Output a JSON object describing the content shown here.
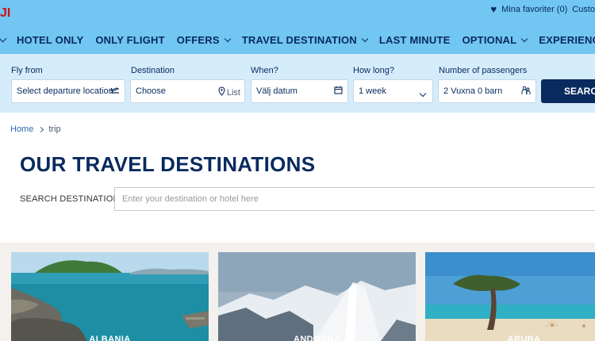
{
  "brand": {
    "logo_text": "JI"
  },
  "utility": {
    "favorites_label": "Mina favoriter (0)",
    "customer_label": "Custo"
  },
  "nav": {
    "items": [
      {
        "label": "HOTEL ONLY",
        "has_dropdown": false
      },
      {
        "label": "ONLY FLIGHT",
        "has_dropdown": false
      },
      {
        "label": "OFFERS",
        "has_dropdown": true
      },
      {
        "label": "TRAVEL DESTINATION",
        "has_dropdown": true
      },
      {
        "label": "LAST MINUTE",
        "has_dropdown": false
      },
      {
        "label": "OPTIONAL",
        "has_dropdown": true
      },
      {
        "label": "EXPERIENCES",
        "has_dropdown": false
      }
    ]
  },
  "search": {
    "fly_from": {
      "label": "Fly from",
      "value": "Select departure location",
      "icon": "plane-departure-icon"
    },
    "destination": {
      "label": "Destination",
      "value": "Choose",
      "list_label": "List",
      "icon": "map-pin-icon"
    },
    "when": {
      "label": "When?",
      "value": "Välj datum",
      "icon": "calendar-icon"
    },
    "how_long": {
      "label": "How long?",
      "value": "1 week",
      "icon": "chevron-down-icon"
    },
    "passengers": {
      "label": "Number of passengers",
      "value": "2 Vuxna 0 barn",
      "icon": "people-icon"
    },
    "button_label": "SEARCH"
  },
  "breadcrumb": {
    "home": "Home",
    "current": "trip"
  },
  "page": {
    "title": "OUR TRAVEL DESTINATIONS",
    "search_label": "SEARCH DESTINATIONS",
    "search_placeholder": "Enter your destination or hotel here"
  },
  "cards": [
    {
      "label": "ALBANIA"
    },
    {
      "label": "ANDORRA"
    },
    {
      "label": "ARUBA"
    }
  ],
  "colors": {
    "header_bg": "#71c6f2",
    "search_bg": "#d5ecfb",
    "navy": "#092a5e",
    "brand_red": "#d40e14"
  }
}
